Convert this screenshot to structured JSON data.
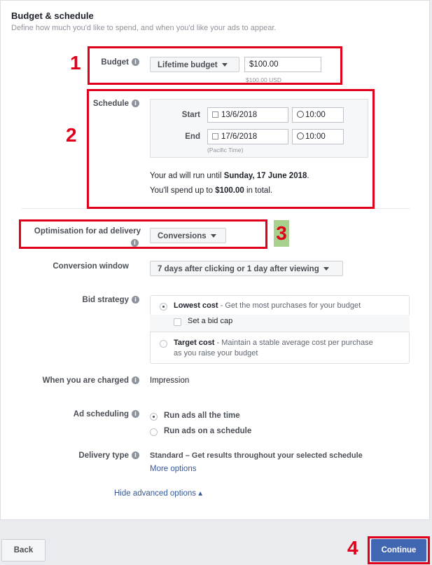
{
  "header": {
    "title": "Budget & schedule",
    "subtitle": "Define how much you'd like to spend, and when you'd like your ads to appear."
  },
  "budget": {
    "label": "Budget",
    "type_value": "Lifetime budget",
    "amount": "$100.00",
    "amount_hint": "$100.00 USD"
  },
  "schedule": {
    "label": "Schedule",
    "start_label": "Start",
    "start_date": "13/6/2018",
    "start_time": "10:00",
    "end_label": "End",
    "end_date": "17/6/2018",
    "end_time": "10:00",
    "timezone": "(Pacific Time)",
    "run_until_prefix": "Your ad will run until ",
    "run_until_date": "Sunday, 17 June 2018",
    "run_until_suffix": ".",
    "spend_prefix": "You'll spend up to ",
    "spend_amount": "$100.00",
    "spend_suffix": " in total."
  },
  "optimisation": {
    "label": "Optimisation for ad delivery",
    "value": "Conversions"
  },
  "conversion_window": {
    "label": "Conversion window",
    "value": "7 days after clicking or 1 day after viewing"
  },
  "bid_strategy": {
    "label": "Bid strategy",
    "lowest_cost_title": "Lowest cost",
    "lowest_cost_desc": " - Get the most purchases for your budget",
    "set_bid_cap": "Set a bid cap",
    "target_cost_title": "Target cost",
    "target_cost_desc_line1": " - Maintain a stable average cost per purchase",
    "target_cost_desc_line2": "as you raise your budget"
  },
  "charged": {
    "label": "When you are charged",
    "value": "Impression"
  },
  "ad_scheduling": {
    "label": "Ad scheduling",
    "option_all": "Run ads all the time",
    "option_schedule": "Run ads on a schedule"
  },
  "delivery_type": {
    "label": "Delivery type",
    "value": "Standard – Get results throughout your selected schedule",
    "more_options": "More options"
  },
  "hide_advanced": "Hide advanced options ▴",
  "annotations": [
    "1",
    "2",
    "3",
    "4"
  ],
  "footer": {
    "back": "Back",
    "continue": "Continue"
  },
  "colors": {
    "annotation_red": "#e0001b",
    "annotation_3_bg": "#a9d18e",
    "primary_blue": "#4267b2",
    "link_blue": "#365899"
  }
}
